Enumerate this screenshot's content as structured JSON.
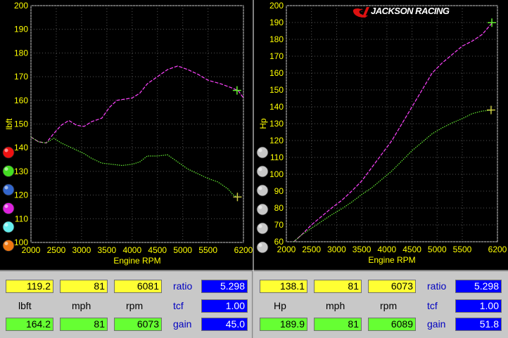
{
  "colors": {
    "series_a": "#ff44ff",
    "series_b": "#66ee33",
    "axis_text": "#ffff00",
    "grid": "#555555"
  },
  "left_swatches": [
    "#ee1111",
    "#44dd22",
    "#3366cc",
    "#dd22dd",
    "#66eeee",
    "#ee7711"
  ],
  "right_swatches": [
    "#c8c8c8",
    "#c8c8c8",
    "#c8c8c8",
    "#c8c8c8",
    "#c8c8c8",
    "#c8c8c8"
  ],
  "logo": {
    "text": "JACKSON RACING"
  },
  "chart_data": [
    {
      "type": "line",
      "xlabel": "Engine RPM",
      "ylabel": "lbft",
      "xlim": [
        2000,
        6200
      ],
      "ylim": [
        100,
        200
      ],
      "x_ticks": [
        2000,
        2500,
        3000,
        3500,
        4000,
        4500,
        5000,
        5500,
        6200
      ],
      "y_ticks": [
        100,
        110,
        120,
        130,
        140,
        150,
        160,
        170,
        180,
        190,
        200
      ],
      "series": [
        {
          "color": "#ff44ff",
          "x": [
            2000,
            2150,
            2300,
            2450,
            2600,
            2750,
            2900,
            3050,
            3200,
            3400,
            3550,
            3700,
            3850,
            4000,
            4150,
            4300,
            4500,
            4700,
            4900,
            5100,
            5300,
            5500,
            5750,
            6000,
            6100,
            6200
          ],
          "y": [
            144.5,
            142.5,
            142,
            146,
            149.5,
            151.5,
            149.5,
            149,
            151,
            152.5,
            157,
            160,
            160.5,
            161,
            163,
            167,
            170,
            173,
            174.5,
            173,
            171,
            168.5,
            167,
            165,
            164,
            161
          ]
        },
        {
          "color": "#66ee33",
          "x": [
            2000,
            2150,
            2300,
            2450,
            2600,
            2750,
            2900,
            3050,
            3200,
            3400,
            3600,
            3800,
            4000,
            4150,
            4300,
            4500,
            4700,
            4900,
            5100,
            5300,
            5500,
            5700,
            5900,
            6000,
            6100
          ],
          "y": [
            144.5,
            142.5,
            142,
            144,
            142,
            140.5,
            139,
            137.5,
            135.5,
            133.5,
            133,
            132.5,
            133,
            134,
            136.5,
            136.5,
            137,
            134,
            131,
            129,
            127,
            125.5,
            122.5,
            120,
            119
          ]
        }
      ],
      "markers": [
        {
          "x": 6073,
          "y": 164.2,
          "color": "#66ee33"
        },
        {
          "x": 6081,
          "y": 119.2,
          "color": "#cccc44"
        }
      ]
    },
    {
      "type": "line",
      "xlabel": "Engine RPM",
      "ylabel": "Hp",
      "xlim": [
        2000,
        6200
      ],
      "ylim": [
        60,
        200
      ],
      "x_ticks": [
        2000,
        2500,
        3000,
        3500,
        4000,
        4500,
        5000,
        5500,
        6200
      ],
      "y_ticks": [
        60,
        70,
        80,
        90,
        100,
        110,
        120,
        130,
        140,
        150,
        160,
        170,
        180,
        190,
        200
      ],
      "series": [
        {
          "color": "#ff44ff",
          "x": [
            2150,
            2300,
            2500,
            2700,
            2900,
            3100,
            3300,
            3500,
            3700,
            3900,
            4100,
            4300,
            4500,
            4700,
            4900,
            5100,
            5300,
            5500,
            5700,
            5900,
            6100
          ],
          "y": [
            60,
            64,
            70,
            75,
            80,
            84.5,
            90,
            96,
            104,
            112,
            120,
            130,
            140,
            150,
            160,
            166,
            171,
            176,
            179,
            183,
            190
          ]
        },
        {
          "color": "#66ee33",
          "x": [
            2150,
            2300,
            2500,
            2700,
            2900,
            3100,
            3300,
            3500,
            3700,
            3900,
            4100,
            4300,
            4500,
            4700,
            4900,
            5100,
            5300,
            5500,
            5700,
            5900,
            6100
          ],
          "y": [
            60,
            64,
            68,
            72,
            76,
            79.5,
            83.5,
            88,
            92,
            97,
            102,
            108,
            114,
            119,
            124,
            127.5,
            130.5,
            133,
            136,
            137.5,
            138
          ]
        }
      ],
      "markers": [
        {
          "x": 6089,
          "y": 189.9,
          "color": "#66ee33"
        },
        {
          "x": 6073,
          "y": 138.1,
          "color": "#cccc44"
        }
      ]
    }
  ],
  "left_readout": {
    "row1": {
      "a": "119.2",
      "b": "81",
      "c": "6081",
      "side_label": "ratio",
      "side_value": "5.298"
    },
    "row2": {
      "a": "lbft",
      "b": "mph",
      "c": "rpm",
      "side_label": "tcf",
      "side_value": "1.00"
    },
    "row3": {
      "a": "164.2",
      "b": "81",
      "c": "6073",
      "side_label": "gain",
      "side_value": "45.0"
    }
  },
  "right_readout": {
    "row1": {
      "a": "138.1",
      "b": "81",
      "c": "6073",
      "side_label": "ratio",
      "side_value": "5.298"
    },
    "row2": {
      "a": "Hp",
      "b": "mph",
      "c": "rpm",
      "side_label": "tcf",
      "side_value": "1.00"
    },
    "row3": {
      "a": "189.9",
      "b": "81",
      "c": "6089",
      "side_label": "gain",
      "side_value": "51.8"
    }
  }
}
